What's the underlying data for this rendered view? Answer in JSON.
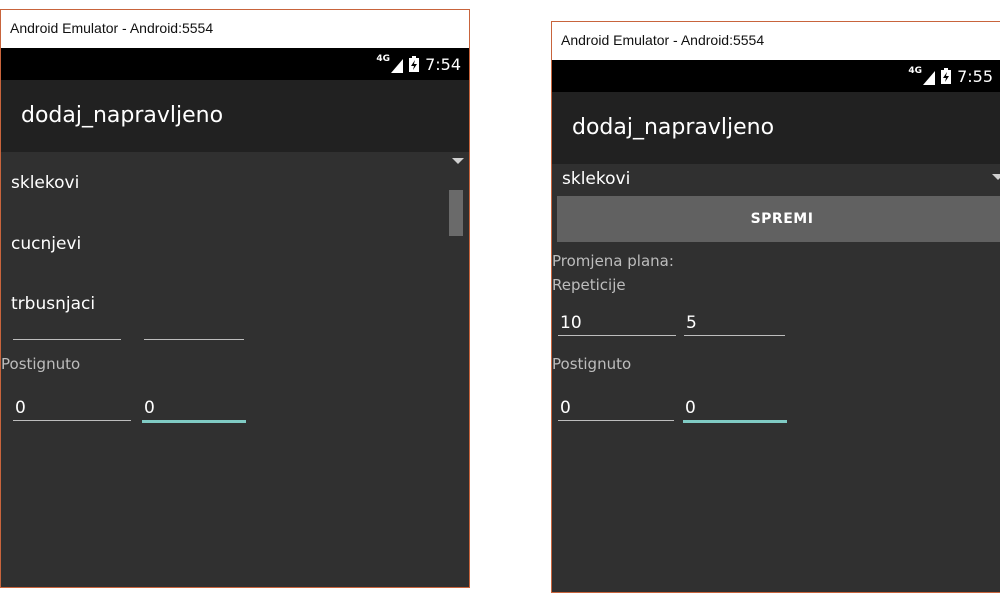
{
  "left": {
    "window_title": "Android Emulator - Android:5554",
    "status": {
      "network": "4G",
      "time": "7:54"
    },
    "app_title": "dodaj_napravljeno",
    "list_items": [
      "sklekovi",
      "cucnjevi",
      "trbusnjaci"
    ],
    "postignuto_label": "Postignuto",
    "postignuto_values": [
      "0",
      "0"
    ]
  },
  "right": {
    "window_title": "Android Emulator - Android:5554",
    "status": {
      "network": "4G",
      "time": "7:55"
    },
    "app_title": "dodaj_napravljeno",
    "spinner_value": "sklekovi",
    "save_button": "SPREMI",
    "promjena_label": "Promjena plana:",
    "repeticije_label": "Repeticije",
    "plan_values": [
      "10",
      "5"
    ],
    "postignuto_label": "Postignuto",
    "postignuto_values": [
      "0",
      "0"
    ]
  },
  "colors": {
    "accent": "#80cbc4",
    "window_border": "#c8643c",
    "screen_bg": "#303030",
    "appbar_bg": "#212121"
  }
}
